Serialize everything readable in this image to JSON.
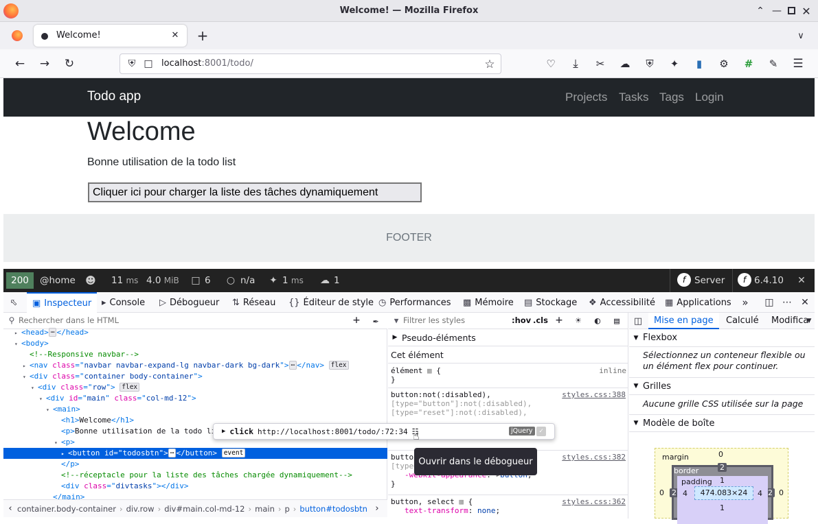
{
  "window": {
    "title": "Welcome! — Mozilla Firefox"
  },
  "tab": {
    "title": "Welcome!"
  },
  "urlbar": {
    "host": "localhost",
    "rest": ":8001/todo/"
  },
  "site": {
    "brand": "Todo app",
    "nav": [
      "Projects",
      "Tasks",
      "Tags",
      "Login"
    ],
    "heading": "Welcome",
    "lead": "Bonne utilisation de la todo list",
    "button": "Cliquer ici pour charger la liste des tâches dynamiquement",
    "footer": "FOOTER"
  },
  "sfbar": {
    "status": "200",
    "route": "@home",
    "time": "11",
    "time_unit": "ms",
    "mem": "4.0",
    "mem_unit": "MiB",
    "forms": "6",
    "user": "n/a",
    "events_time": "1",
    "events_unit": "ms",
    "requests": "1",
    "server": "Server",
    "version": "6.4.10"
  },
  "devtools": {
    "tabs": [
      "Inspecteur",
      "Console",
      "Débogueur",
      "Réseau",
      "Éditeur de style",
      "Performances",
      "Mémoire",
      "Stockage",
      "Accessibilité",
      "Applications"
    ],
    "search_placeholder": "Rechercher dans le HTML",
    "filter_placeholder": "Filtrer les styles",
    "hov": ":hov",
    "cls": ".cls",
    "layout_tabs": [
      "Mise en page",
      "Calculé",
      "Modifica"
    ],
    "breadcrumb": [
      "container.body-container",
      "div.row",
      "div#main.col-md-12",
      "main",
      "p",
      "button#todosbtn"
    ],
    "pseudo": "Pseudo-éléments",
    "this_el": "Cet élément",
    "element_rule": "élément",
    "inline": "inline",
    "rule1_sel": "button:not(:disabled),",
    "rule1_l2": "[type=\"button\"]:not(:disabled),",
    "rule1_l3": "[type=\"reset\"]:not(:disabled),",
    "rule1_src": "styles.css:388",
    "rule2_sel": "button,",
    "rule2_l2": "[type=\"button\"]",
    "rule2_prop": "-webkit-appearance",
    "rule2_val": "button",
    "rule2_src": "styles.css:382",
    "rule3_sel": "button, select",
    "rule3_prop": "text-transform",
    "rule3_val": "none",
    "rule3_src": "styles.css:362",
    "flexbox": "Flexbox",
    "flex_msg": "Sélectionnez un conteneur flexible ou un élément flex pour continuer.",
    "grids": "Grilles",
    "grid_msg": "Aucune grille CSS utilisée sur la page",
    "boxmodel": "Modèle de boîte",
    "box": {
      "margin": "margin",
      "border": "border",
      "padding": "padding",
      "size": "474.083×24",
      "m_top": "0",
      "m_left": "0",
      "m_right": "0",
      "b_top": "2",
      "b_left": "2",
      "b_right": "2",
      "p_top": "1",
      "p_left": "4",
      "p_right": "4",
      "p_bottom": "1"
    },
    "popup": {
      "event": "click",
      "url": "http://localhost:8001/todo/:72:34",
      "lib": "jQuery"
    },
    "tooltip": "Ouvrir dans le débogueur",
    "markup": {
      "head": "head",
      "body": "body",
      "c_nav": "<!--Responsive navbar-->",
      "nav_class": "navbar navbar-expand-lg navbar-dark bg-dark",
      "div_class": "container body-container",
      "row_class": "row",
      "main_id": "main",
      "main_class": "col-md-12",
      "h1": "Welcome",
      "p_text": "Bonne utilisation de la todo li",
      "btn_id": "todosbtn",
      "c_tasks": "<!--réceptacle pour la liste des tâches chargée dynamiquement-->",
      "divtasks": "divtasks",
      "flex": "flex",
      "event": "event"
    }
  }
}
